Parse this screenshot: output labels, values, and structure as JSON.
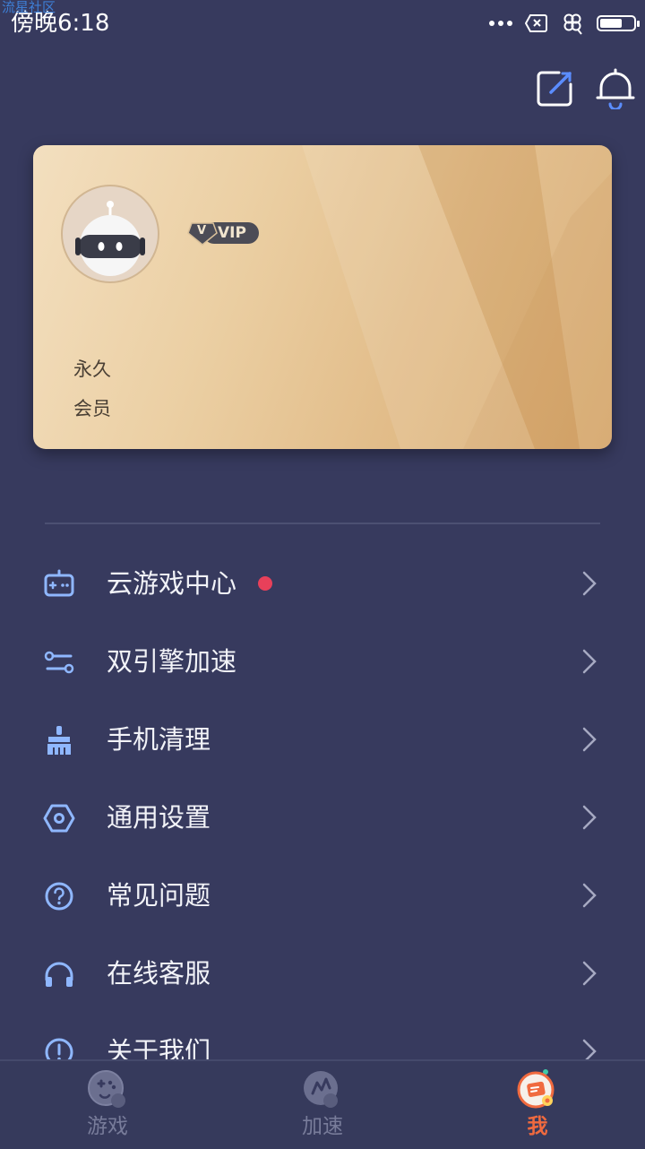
{
  "watermark": "流星社区",
  "status_bar": {
    "time": "傍晚6:18"
  },
  "header": {
    "icons": [
      "edit-icon",
      "bell-icon"
    ]
  },
  "vip_card": {
    "badge_label": "VIP",
    "badge_glyph": "V",
    "membership_term": "永久",
    "membership_type": "会员"
  },
  "menu": {
    "items": [
      {
        "label": "云游戏中心",
        "icon": "gamepad-icon",
        "has_red_dot": true
      },
      {
        "label": "双引擎加速",
        "icon": "dual-engine-icon"
      },
      {
        "label": "手机清理",
        "icon": "broom-icon"
      },
      {
        "label": "通用设置",
        "icon": "settings-hex-icon"
      },
      {
        "label": "常见问题",
        "icon": "question-icon"
      },
      {
        "label": "在线客服",
        "icon": "headset-icon"
      },
      {
        "label": "关于我们",
        "icon": "info-icon"
      }
    ]
  },
  "tab_bar": {
    "tabs": [
      {
        "label": "游戏",
        "icon": "games-tab-icon",
        "active": false
      },
      {
        "label": "加速",
        "icon": "boost-tab-icon",
        "active": false
      },
      {
        "label": "我",
        "icon": "me-tab-icon",
        "active": true
      }
    ]
  },
  "colors": {
    "background": "#373a5e",
    "accent_icon": "#8fb7ff",
    "active_tab": "#f06a3f",
    "red_dot": "#e8405a",
    "card_gold": "#e2bd8a"
  }
}
